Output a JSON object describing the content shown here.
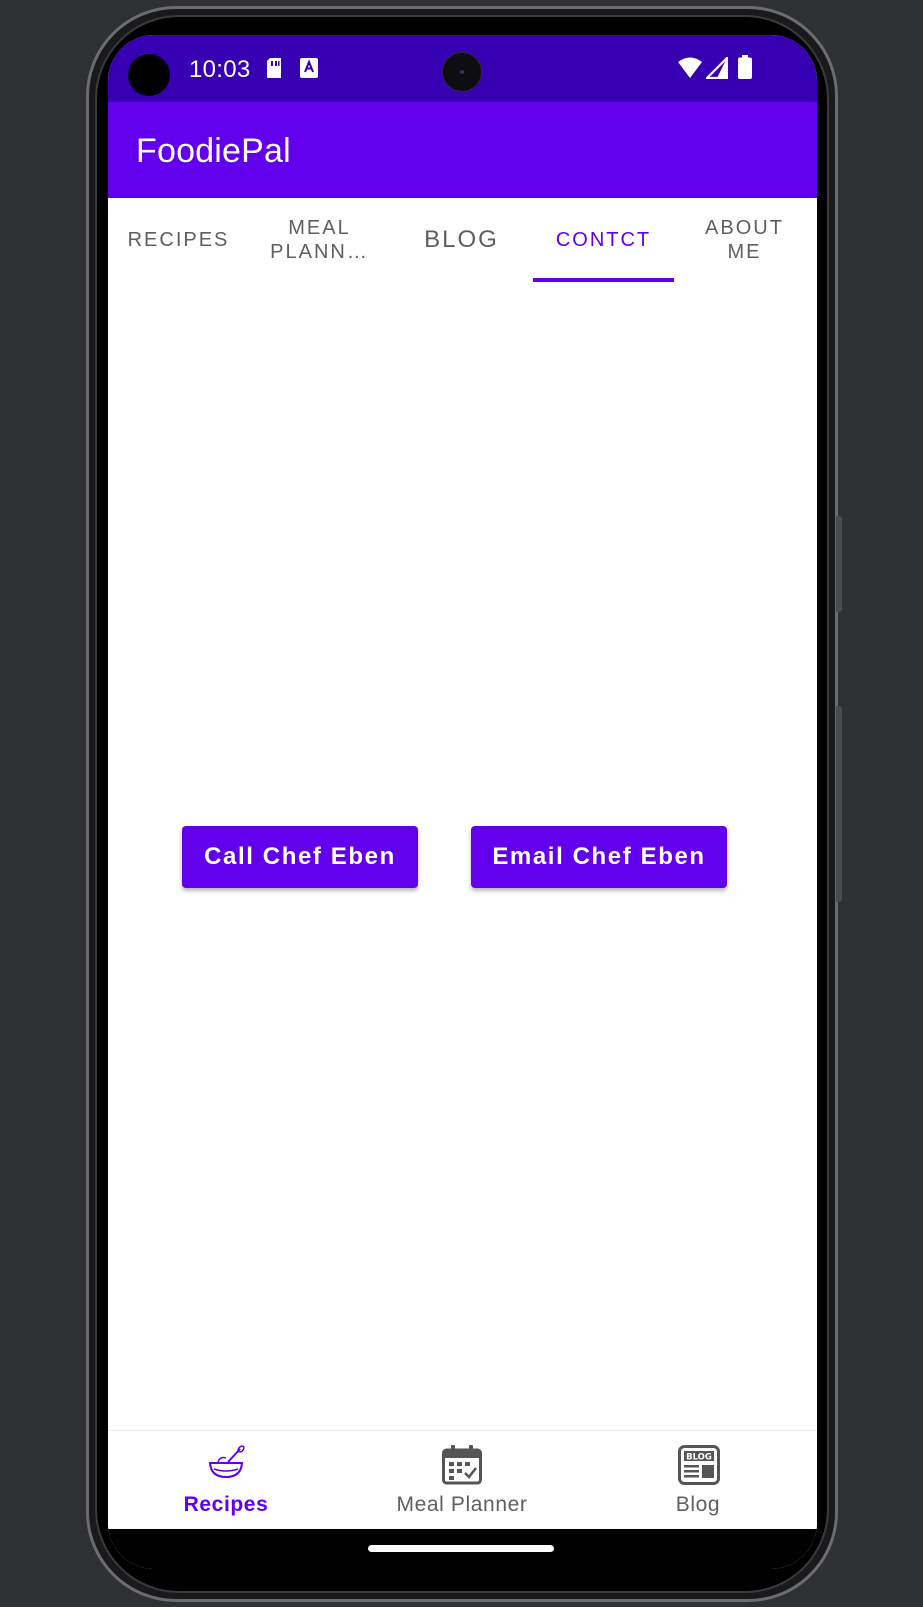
{
  "status_bar": {
    "time": "10:03",
    "icons": [
      "sd-card-icon",
      "keyboard-a-icon",
      "wifi-icon",
      "signal-icon",
      "battery-icon"
    ]
  },
  "app_bar": {
    "title": "FoodiePal"
  },
  "tabs": [
    {
      "label": "RECIPES",
      "active": false
    },
    {
      "label": "MEAL\nPLANN…",
      "active": false
    },
    {
      "label": "BLOG",
      "active": false
    },
    {
      "label": "CONTCT",
      "active": true
    },
    {
      "label": "ABOUT\nME",
      "active": false
    }
  ],
  "contact": {
    "call_label": "Call Chef Eben",
    "email_label": "Email Chef Eben"
  },
  "bottom_nav": [
    {
      "label": "Recipes",
      "icon": "mixing-bowl-icon",
      "active": true
    },
    {
      "label": "Meal Planner",
      "icon": "calendar-icon",
      "active": false
    },
    {
      "label": "Blog",
      "icon": "blog-icon",
      "active": false
    }
  ],
  "colors": {
    "primary": "#6200ee",
    "primary_dark": "#3700b3",
    "surface": "#ffffff",
    "inactive": "#5f5f5f"
  }
}
